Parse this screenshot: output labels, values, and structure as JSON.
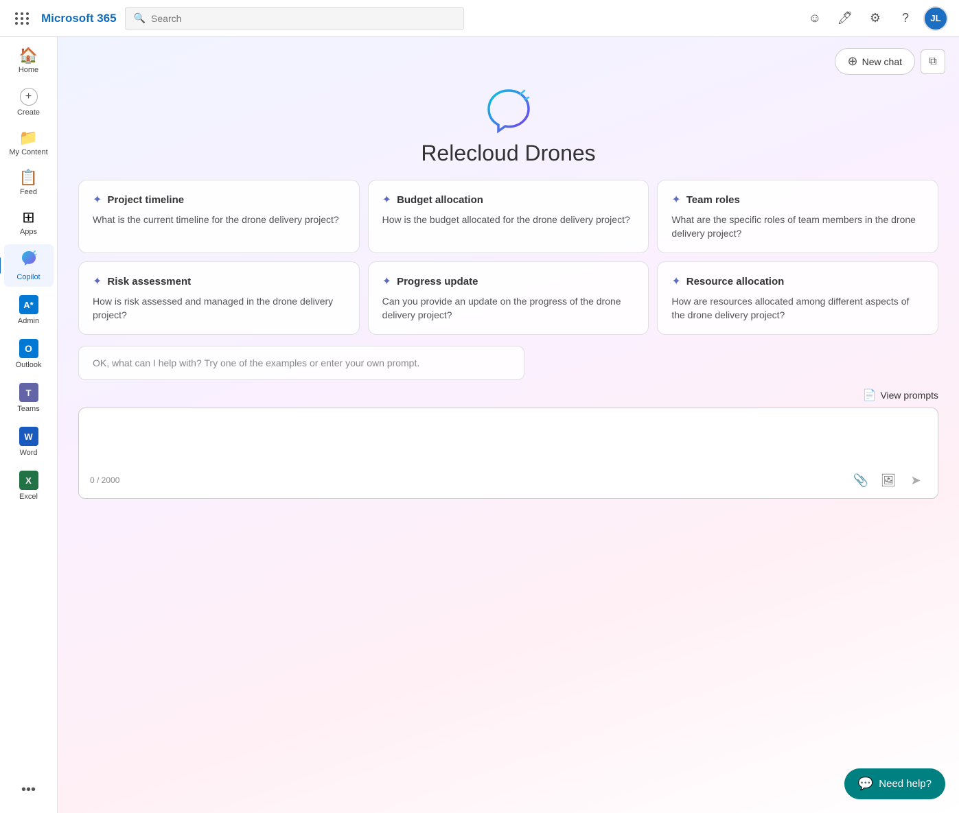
{
  "topbar": {
    "brand": "Microsoft 365",
    "search_placeholder": "Search",
    "avatar_initials": "JL"
  },
  "sidebar": {
    "items": [
      {
        "id": "home",
        "label": "Home",
        "icon": "🏠"
      },
      {
        "id": "create",
        "label": "Create",
        "icon": "➕"
      },
      {
        "id": "my-content",
        "label": "My Content",
        "icon": "📁"
      },
      {
        "id": "feed",
        "label": "Feed",
        "icon": "📋"
      },
      {
        "id": "apps",
        "label": "Apps",
        "icon": "⊞"
      },
      {
        "id": "copilot",
        "label": "Copilot",
        "icon": "copilot"
      },
      {
        "id": "admin",
        "label": "Admin",
        "icon": "admin"
      },
      {
        "id": "outlook",
        "label": "Outlook",
        "icon": "outlook"
      },
      {
        "id": "teams",
        "label": "Teams",
        "icon": "teams"
      },
      {
        "id": "word",
        "label": "Word",
        "icon": "word"
      },
      {
        "id": "excel",
        "label": "Excel",
        "icon": "excel"
      }
    ],
    "more_label": "···"
  },
  "content": {
    "new_chat_label": "New chat",
    "hero_title": "Relecloud Drones",
    "cards": [
      {
        "id": "project-timeline",
        "title": "Project timeline",
        "body": "What is the current timeline for the drone delivery project?"
      },
      {
        "id": "budget-allocation",
        "title": "Budget allocation",
        "body": "How is the budget allocated for the drone delivery project?"
      },
      {
        "id": "team-roles",
        "title": "Team roles",
        "body": "What are the specific roles of team members in the drone delivery project?"
      },
      {
        "id": "risk-assessment",
        "title": "Risk assessment",
        "body": "How is risk assessed and managed in the drone delivery project?"
      },
      {
        "id": "progress-update",
        "title": "Progress update",
        "body": "Can you provide an update on the progress of the drone delivery project?"
      },
      {
        "id": "resource-allocation",
        "title": "Resource allocation",
        "body": "How are resources allocated among different aspects of the drone delivery project?"
      }
    ],
    "prompt_suggestion": "OK, what can I help with? Try one of the examples or enter your own prompt.",
    "view_prompts_label": "View prompts",
    "char_count": "0 / 2000",
    "need_help_label": "Need help?"
  }
}
